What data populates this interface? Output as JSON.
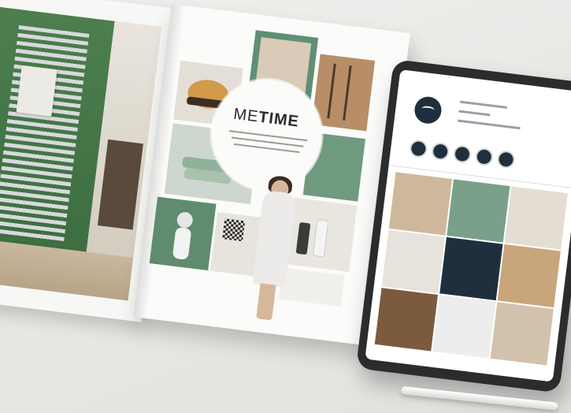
{
  "scene": {
    "magazine": {
      "headline_me": "ME",
      "headline_time": "TIME"
    },
    "colors": {
      "sage_green": "#5f8f74",
      "deep_green": "#3d6e41",
      "wood": "#b78e67",
      "tablet_frame": "#2b2c2e",
      "brand_navy": "#1f2f3d"
    },
    "icons": [
      "qr-code-icon",
      "towel-hook-icon",
      "profile-logo-icon"
    ]
  }
}
